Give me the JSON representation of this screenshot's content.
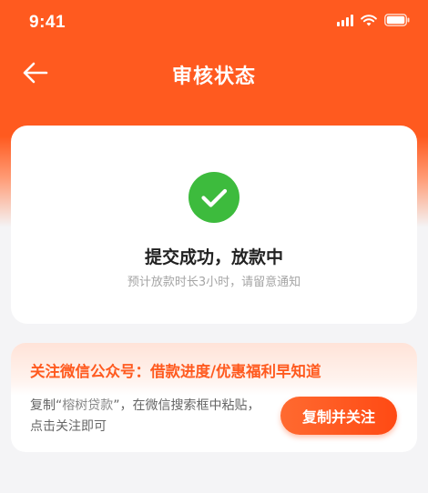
{
  "status_bar": {
    "time": "9:41"
  },
  "header": {
    "title": "审核状态",
    "back_icon": "arrow-left-icon"
  },
  "status_card": {
    "icon": "check-circle-icon",
    "icon_color": "#3dbb3d",
    "title": "提交成功，放款中",
    "subtitle": "预计放款时长3小时，请留意通知"
  },
  "wechat_card": {
    "title": "关注微信公众号：借款进度/优惠福利早知道",
    "desc_prefix": "复制“",
    "desc_highlight": "榕树贷款",
    "desc_suffix": "”，在微信搜索框中粘贴，点击关注即可",
    "button_label": "复制并关注"
  },
  "colors": {
    "accent": "#ff5a1f",
    "background": "#f4f4f6"
  }
}
